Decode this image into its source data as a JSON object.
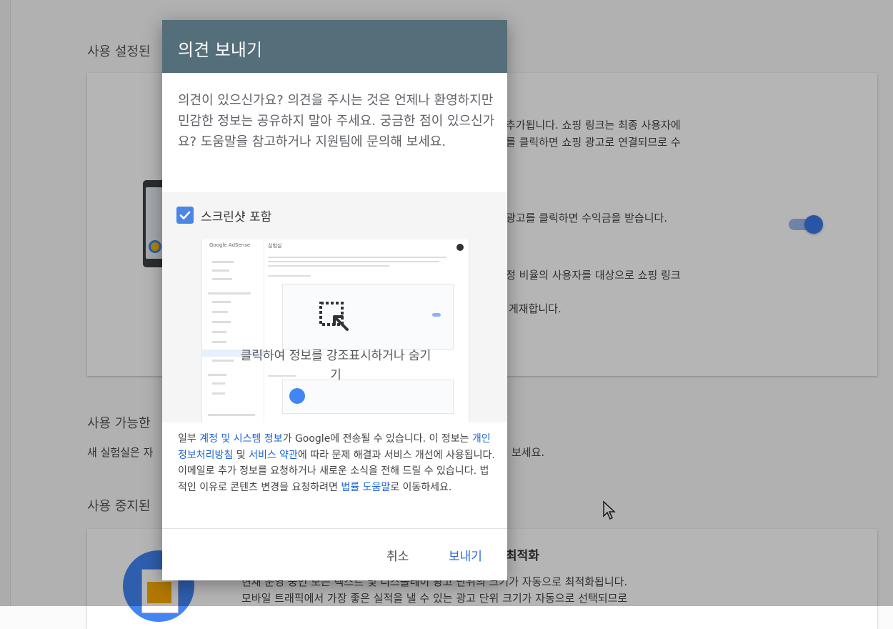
{
  "background": {
    "section_enabled": "사용 설정된",
    "card1_lines": [
      "추가됩니다. 쇼핑 링크는 최종 사용자에",
      "를 클릭하면 쇼핑 광고로 연결되므로 수",
      "광고를 클릭하면 수익금을 받습니다.",
      "정 비율의 사용자를 대상으로 쇼핑 링크",
      "게재합니다."
    ],
    "section_available": "사용 가능한",
    "available_line_left": "새 실험실은 자",
    "available_line_right": "보세요.",
    "section_disabled": "사용 중지된",
    "card2_title": "최적화",
    "card2_lines": [
      "현재 운영 중인 모든 텍스트 및 디스플레이 광고 단위의 크기가 자동으로 최적화됩니다.",
      "모바일 트래픽에서 가장 좋은 실적을 낼 수 있는 광고 단위 크기가 자동으로 선택되므로"
    ],
    "toggle_state": "on",
    "accent_color": "#3b78e7"
  },
  "dialog": {
    "title": "의견 보내기",
    "header_color": "#546e7a",
    "intro": "의견이 있으신가요? 의견을 주시는 것은 언제나 환영하지만 민감한 정보는 공유하지 말아 주세요. 궁금한 점이 있으신가요? 도움말을 참고하거나 지원팀에 문의해 보세요.",
    "screenshot_checkbox": {
      "label": "스크린샷 포함",
      "checked": true
    },
    "preview": {
      "logo_text": "Google AdSense",
      "page_title": "실험실",
      "hint": "클릭하여 정보를 강조표시하거나 숨기기",
      "highlight_icon": "highlight-cursor-icon"
    },
    "legal": {
      "part1": "일부 ",
      "link_system": "계정 및 시스템 정보",
      "part2": "가 Google에 전송될 수 있습니다. 이 정보는 ",
      "link_privacy": "개인정보처리방침",
      "part3": " 및 ",
      "link_terms": "서비스 약관",
      "part4": "에 따라 문제 해결과 서비스 개선에 사용됩니다. 이메일로 추가 정보를 요청하거나 새로운 소식을 전해 드릴 수 있습니다. 법적인 이유로 콘텐츠 변경을 요청하려면 ",
      "link_legal": "법률 도움말",
      "part5": "로 이동하세요.",
      "link_color": "#1a63d8"
    },
    "buttons": {
      "cancel": "취소",
      "send": "보내기",
      "send_color": "#2b6ad8"
    }
  }
}
